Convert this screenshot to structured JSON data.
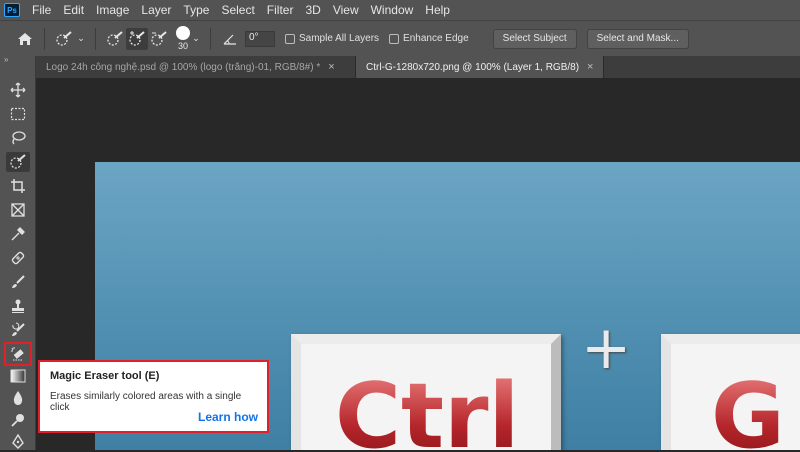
{
  "app": {
    "logo_text": "Ps"
  },
  "menu": [
    "File",
    "Edit",
    "Image",
    "Layer",
    "Type",
    "Select",
    "Filter",
    "3D",
    "View",
    "Window",
    "Help"
  ],
  "options": {
    "brush_size": "30",
    "angle_value": "0°",
    "sample_all_layers_label": "Sample All Layers",
    "enhance_edge_label": "Enhance Edge",
    "select_subject_label": "Select Subject",
    "select_and_mask_label": "Select and Mask..."
  },
  "tabs": [
    {
      "label": "Logo 24h công nghệ.psd @ 100% (logo (trắng)-01, RGB/8#) *",
      "active": false
    },
    {
      "label": "Ctrl-G-1280x720.png @ 100% (Layer 1, RGB/8)",
      "active": true
    }
  ],
  "tab_close_glyph": "×",
  "canvas": {
    "key1_text": "Ctrl",
    "plus_text": "+",
    "key2_text": "G"
  },
  "tooltip": {
    "title": "Magic Eraser tool (E)",
    "description": "Erases similarly colored areas with a single click",
    "link": "Learn how"
  },
  "colors": {
    "highlight": "#e0202b",
    "link": "#1473e6"
  }
}
